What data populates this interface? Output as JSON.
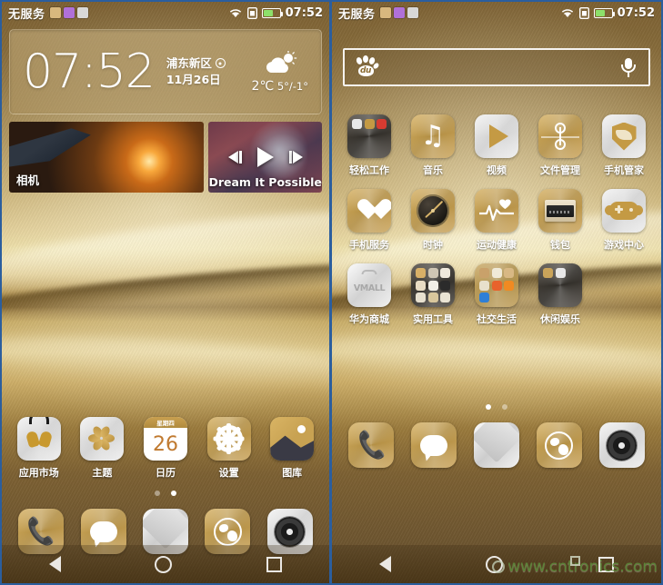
{
  "status_bar": {
    "carrier": "无服务",
    "time": "07:52",
    "notification_icons": [
      "note-icon",
      "music-icon",
      "contact-icon"
    ],
    "wifi_icon": "wifi-icon",
    "sim_icon": "sim-card-icon",
    "battery_icon": "battery-icon"
  },
  "left_screen": {
    "clock_widget": {
      "time": "07:52",
      "location": "浦东新区",
      "date": "11月26日",
      "weather_icon": "partly-cloudy-icon",
      "current_temp": "2℃",
      "temp_range": "5°/-1°"
    },
    "media_widgets": {
      "photo_label": "相机",
      "music_title": "Dream It Possible",
      "prev_label": "上一首",
      "play_label": "播放",
      "next_label": "下一首"
    },
    "apps": [
      {
        "label": "应用市场",
        "icon": "huawei-appstore-icon"
      },
      {
        "label": "主题",
        "icon": "themes-icon"
      },
      {
        "label": "日历",
        "icon": "calendar-icon",
        "cal_weekday": "星期四",
        "cal_day": "26"
      },
      {
        "label": "设置",
        "icon": "settings-gear-icon"
      },
      {
        "label": "图库",
        "icon": "gallery-icon"
      }
    ],
    "page_dots": {
      "count": 2,
      "active": 1
    }
  },
  "right_screen": {
    "search_widget": {
      "engine_icon": "baidu-paw-icon",
      "engine_text": "du",
      "placeholder": "",
      "voice_icon": "microphone-icon"
    },
    "apps": [
      {
        "label": "轻松工作",
        "icon": "work-folder-icon",
        "type": "folder-dark",
        "minis": [
          "#e8e8e8",
          "#c49a44",
          "#d63b31"
        ]
      },
      {
        "label": "音乐",
        "icon": "music-note-icon",
        "type": "gold"
      },
      {
        "label": "视频",
        "icon": "video-play-icon",
        "type": "silver"
      },
      {
        "label": "文件管理",
        "icon": "file-manager-icon",
        "type": "gold"
      },
      {
        "label": "手机管家",
        "icon": "phone-manager-shield-icon",
        "type": "silver"
      },
      {
        "label": "手机服务",
        "icon": "phone-service-heart-icon",
        "type": "gold"
      },
      {
        "label": "时钟",
        "icon": "clock-icon",
        "type": "gold"
      },
      {
        "label": "运动健康",
        "icon": "health-ecg-icon",
        "type": "gold"
      },
      {
        "label": "钱包",
        "icon": "wallet-icon",
        "type": "gold"
      },
      {
        "label": "游戏中心",
        "icon": "game-center-icon",
        "type": "silver"
      },
      {
        "label": "华为商城",
        "icon": "vmall-icon",
        "type": "silver",
        "brand_text": "VMALL"
      },
      {
        "label": "实用工具",
        "icon": "tools-folder-icon",
        "type": "folder-dark",
        "minis": [
          "#d8b067",
          "#cfc6b4",
          "#efe9dc",
          "#e8dcc4",
          "#f2efe6",
          "#2b2b2b",
          "#e7e0cf",
          "#d9c79c",
          "#eae4d4"
        ]
      },
      {
        "label": "社交生活",
        "icon": "social-folder-icon",
        "type": "folder-gold",
        "minis": [
          "#c9a16a",
          "#f0ead8",
          "#d8b884",
          "#e8e0cc",
          "#e8622c",
          "#f08a22",
          "#2f7fd6"
        ]
      },
      {
        "label": "休闲娱乐",
        "icon": "entertainment-folder-icon",
        "type": "folder-dark",
        "minis": [
          "#caa45a",
          "#e8e8e8"
        ]
      }
    ],
    "page_dots": {
      "count": 2,
      "active": 0
    }
  },
  "dock": [
    {
      "label": "电话",
      "icon": "phone-icon",
      "type": "gold"
    },
    {
      "label": "信息",
      "icon": "messages-icon",
      "type": "gold"
    },
    {
      "label": "电子邮件",
      "icon": "email-icon",
      "type": "silver"
    },
    {
      "label": "浏览器",
      "icon": "browser-globe-icon",
      "type": "gold"
    },
    {
      "label": "相机",
      "icon": "camera-icon",
      "type": "silver"
    }
  ],
  "nav_bar": {
    "back_label": "返回",
    "home_label": "主屏幕",
    "recents_label": "最近任务"
  },
  "watermark": {
    "text": "www.cntronics.com",
    "color": "#5d8a3a"
  }
}
